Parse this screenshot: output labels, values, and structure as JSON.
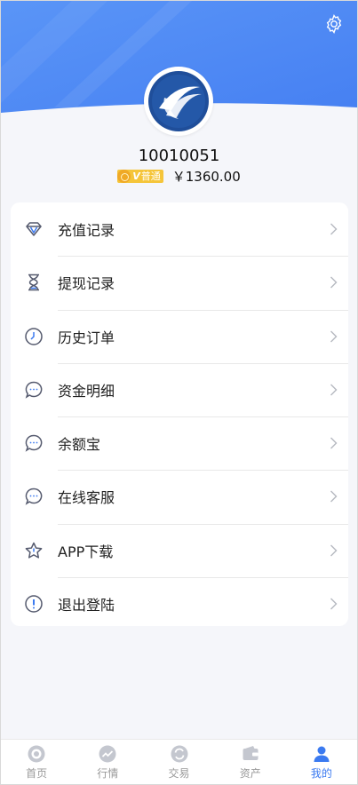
{
  "colors": {
    "accent": "#3b7af0",
    "hero": "#4a86f5",
    "vip": "#f5c53a",
    "icon": "#555a6e",
    "tab_inactive": "#c4c7cf"
  },
  "header": {
    "settings_icon": "gear-icon",
    "avatar_icon": "logo-avatar"
  },
  "user": {
    "id": "10010051",
    "vip_label": "普通",
    "vip_prefix": "V",
    "balance": "￥1360.00"
  },
  "menu": [
    {
      "label": "充值记录",
      "icon": "diamond-icon"
    },
    {
      "label": "提现记录",
      "icon": "hourglass-icon"
    },
    {
      "label": "历史订单",
      "icon": "clock-icon"
    },
    {
      "label": "资金明细",
      "icon": "chat-bubble-icon"
    },
    {
      "label": "余额宝",
      "icon": "chat-bubble-icon"
    },
    {
      "label": "在线客服",
      "icon": "chat-bubble-icon"
    },
    {
      "label": "APP下载",
      "icon": "star-icon"
    },
    {
      "label": "退出登陆",
      "icon": "exclamation-icon"
    }
  ],
  "tabbar": [
    {
      "label": "首页",
      "icon": "home-icon",
      "active": false
    },
    {
      "label": "行情",
      "icon": "trend-icon",
      "active": false
    },
    {
      "label": "交易",
      "icon": "trade-icon",
      "active": false
    },
    {
      "label": "资产",
      "icon": "wallet-icon",
      "active": false
    },
    {
      "label": "我的",
      "icon": "person-icon",
      "active": true
    }
  ]
}
